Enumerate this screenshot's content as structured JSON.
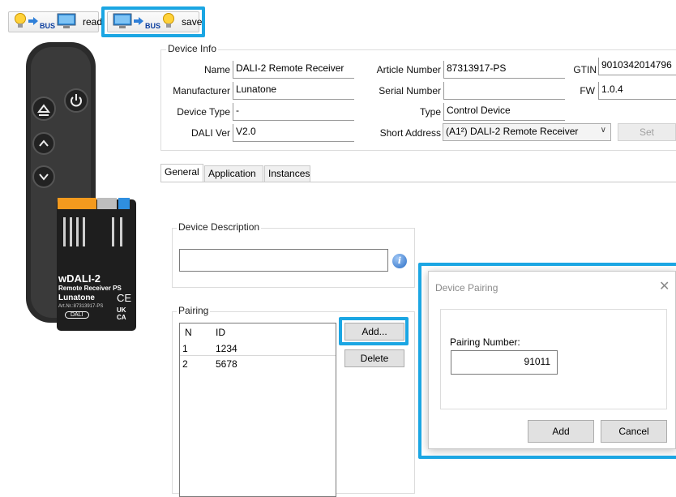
{
  "toolbar": {
    "read_label": "read",
    "save_label": "save",
    "bus_text": "BUS"
  },
  "device_info": {
    "title": "Device Info",
    "name_label": "Name",
    "name_value": "DALI-2 Remote Receiver",
    "manufacturer_label": "Manufacturer",
    "manufacturer_value": "Lunatone",
    "device_type_label": "Device Type",
    "device_type_value": "-",
    "dali_ver_label": "DALI Ver",
    "dali_ver_value": "V2.0",
    "article_number_label": "Article Number",
    "article_number_value": "87313917-PS",
    "serial_number_label": "Serial Number",
    "serial_number_value": "",
    "type_label": "Type",
    "type_value": "Control Device",
    "short_address_label": "Short Address",
    "short_address_value": "(A1²) DALI-2 Remote Receiver",
    "set_label": "Set",
    "gtin_label": "GTIN",
    "gtin_value": "9010342014796",
    "fw_label": "FW",
    "fw_value": "1.0.4"
  },
  "tabs": [
    {
      "label": "General"
    },
    {
      "label": "Application"
    },
    {
      "label": "Instances"
    }
  ],
  "device_description": {
    "title": "Device Description",
    "value": ""
  },
  "pairing": {
    "title": "Pairing",
    "columns": [
      "N",
      "ID"
    ],
    "rows": [
      {
        "n": "1",
        "id": "1234"
      },
      {
        "n": "2",
        "id": "5678"
      }
    ],
    "add_label": "Add...",
    "delete_label": "Delete"
  },
  "dialog": {
    "title": "Device Pairing",
    "pairing_number_label": "Pairing Number:",
    "pairing_number_value": "91011",
    "add_label": "Add",
    "cancel_label": "Cancel"
  },
  "device_image": {
    "product_name": "wDALI-2",
    "product_sub": "Remote Receiver PS",
    "brand": "Lunatone",
    "article": "Art.Nr.:87313917-PS",
    "logo": "DALI",
    "ce_mark": "CE",
    "ukca_mark": "UK CA"
  },
  "colors": {
    "highlight": "#1ba6e3",
    "remote_body": "#2b2b2b",
    "module_body": "#1e1e1e",
    "terminal_orange": "#f39a1e",
    "terminal_blue": "#2f8fe0"
  }
}
